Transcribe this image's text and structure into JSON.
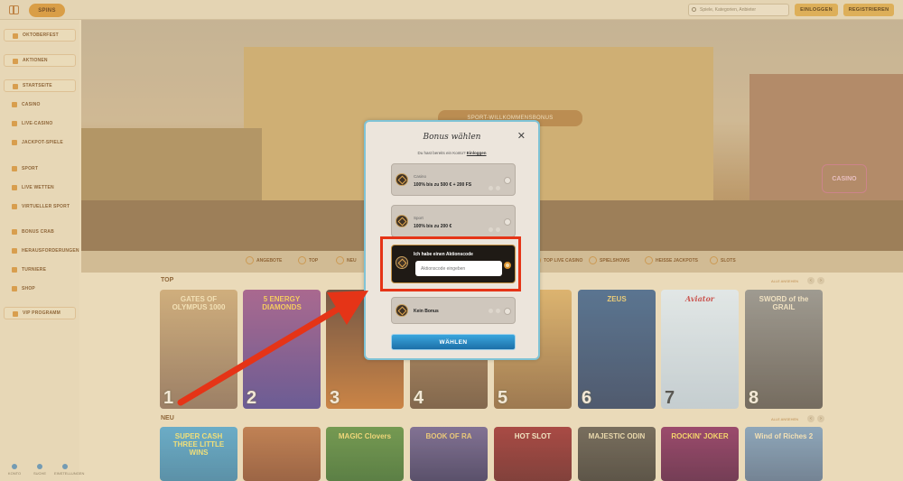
{
  "header": {
    "logo_text": "SPINS",
    "search_placeholder": "Spiele, Kategorien, Anbieter",
    "login_label": "EINLOGGEN",
    "register_label": "REGISTRIEREN"
  },
  "sidebar": {
    "items": [
      {
        "label": "OKTOBERFEST"
      },
      {
        "label": "AKTIONEN"
      },
      {
        "label": "STARTSEITE"
      },
      {
        "label": "CASINO"
      },
      {
        "label": "LIVE-CASINO"
      },
      {
        "label": "JACKPOT-SPIELE"
      },
      {
        "label": "SPORT"
      },
      {
        "label": "LIVE WETTEN"
      },
      {
        "label": "VIRTUELLER SPORT"
      },
      {
        "label": "BONUS CRAB"
      },
      {
        "label": "HERAUSFORDERUNGEN"
      },
      {
        "label": "TURNIERE"
      },
      {
        "label": "SHOP"
      },
      {
        "label": "VIP PROGRAMM"
      }
    ],
    "footer": [
      "KONTO",
      "SUCHE",
      "EINSTELLUNGEN"
    ]
  },
  "hero": {
    "banner_text": "SPORT-WILLKOMMENSBONUS",
    "casino_sign": "CASINO"
  },
  "categories": [
    "ANGEBOTE",
    "TOP",
    "NEU",
    "TOP LIVE CASINO",
    "SPIELSHOWS",
    "HEISSE JACKPOTS",
    "SLOTS"
  ],
  "sections": {
    "top": {
      "title": "TOP",
      "link": "ALLE ANSEHEN",
      "games": [
        {
          "name": "GATES OF OLYMPUS 1000",
          "rank": "1"
        },
        {
          "name": "5 ENERGY DIAMONDS",
          "rank": "2"
        },
        {
          "name": "",
          "rank": "3"
        },
        {
          "name": "",
          "rank": "4"
        },
        {
          "name": "",
          "rank": "5"
        },
        {
          "name": "ZEUS",
          "rank": "6"
        },
        {
          "name": "Aviator",
          "rank": "7"
        },
        {
          "name": "SWORD of the GRAIL",
          "rank": "8"
        }
      ]
    },
    "new": {
      "title": "NEU",
      "link": "ALLE ANSEHEN",
      "games": [
        {
          "name": "SUPER CASH THREE LITTLE WINS"
        },
        {
          "name": ""
        },
        {
          "name": "MAGIC Clovers"
        },
        {
          "name": "BOOK OF RA"
        },
        {
          "name": "HOT SLOT"
        },
        {
          "name": "MAJESTIC ODIN"
        },
        {
          "name": "ROCKIN' JOKER"
        },
        {
          "name": "Wind of Riches 2"
        }
      ]
    }
  },
  "modal": {
    "title": "Bonus wählen",
    "subtitle_prefix": "Du hast bereits ein Konto?",
    "subtitle_link": "Einloggen",
    "options": [
      {
        "line1": "Casino",
        "line2": "100% bis zu 500 € + 200 FS",
        "selected": false
      },
      {
        "line1": "Sport",
        "line2": "100% bis zu 200 €",
        "selected": false
      },
      {
        "line1": "",
        "line2": "Ich habe einen Aktionscode",
        "selected": true,
        "input_placeholder": "Aktionscode eingeben"
      },
      {
        "line1": "",
        "line2": "Kein Bonus",
        "selected": false
      }
    ],
    "choose_label": "WÄHLEN"
  },
  "colors": {
    "accent": "#d8902d",
    "highlight_box": "#e53417",
    "arrow": "#e53417",
    "modal_border": "#7fc3d6",
    "button_blue": "#1c6fa8"
  }
}
